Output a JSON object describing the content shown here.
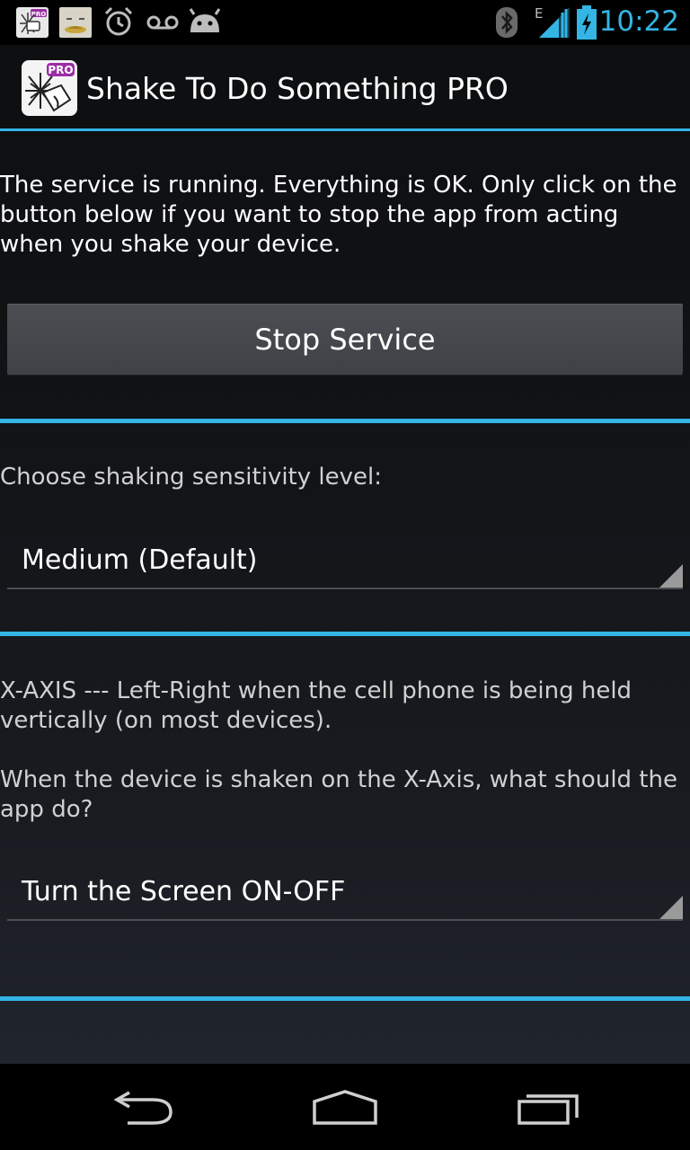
{
  "status_bar": {
    "time": "10:22",
    "network_label": "E",
    "icons": [
      "app-pro-icon",
      "sleeping-app-icon",
      "alarm-clock-icon",
      "voicemail-icon",
      "android-icon",
      "bluetooth-icon",
      "signal-icon",
      "battery-charging-icon"
    ]
  },
  "action_bar": {
    "title": "Shake To Do Something PRO",
    "icon_badge": "PRO"
  },
  "service": {
    "message": "The service is running. Everything is OK. Only click on the button below if you want to stop the app from acting when you shake your device.",
    "stop_button_label": "Stop Service"
  },
  "sensitivity": {
    "label": "Choose shaking sensitivity level:",
    "selected": "Medium (Default)"
  },
  "x_axis": {
    "description": "X-AXIS --- Left-Right when the cell phone is being held vertically (on most devices).",
    "question": "When the device is shaken on the X-Axis, what should the app do?",
    "selected": "Turn the Screen ON-OFF"
  },
  "nav_bar": {
    "icons": [
      "back-icon",
      "home-icon",
      "recent-apps-icon"
    ]
  },
  "colors": {
    "accent": "#33b5e5",
    "background": "#101214",
    "button": "#44474b"
  }
}
